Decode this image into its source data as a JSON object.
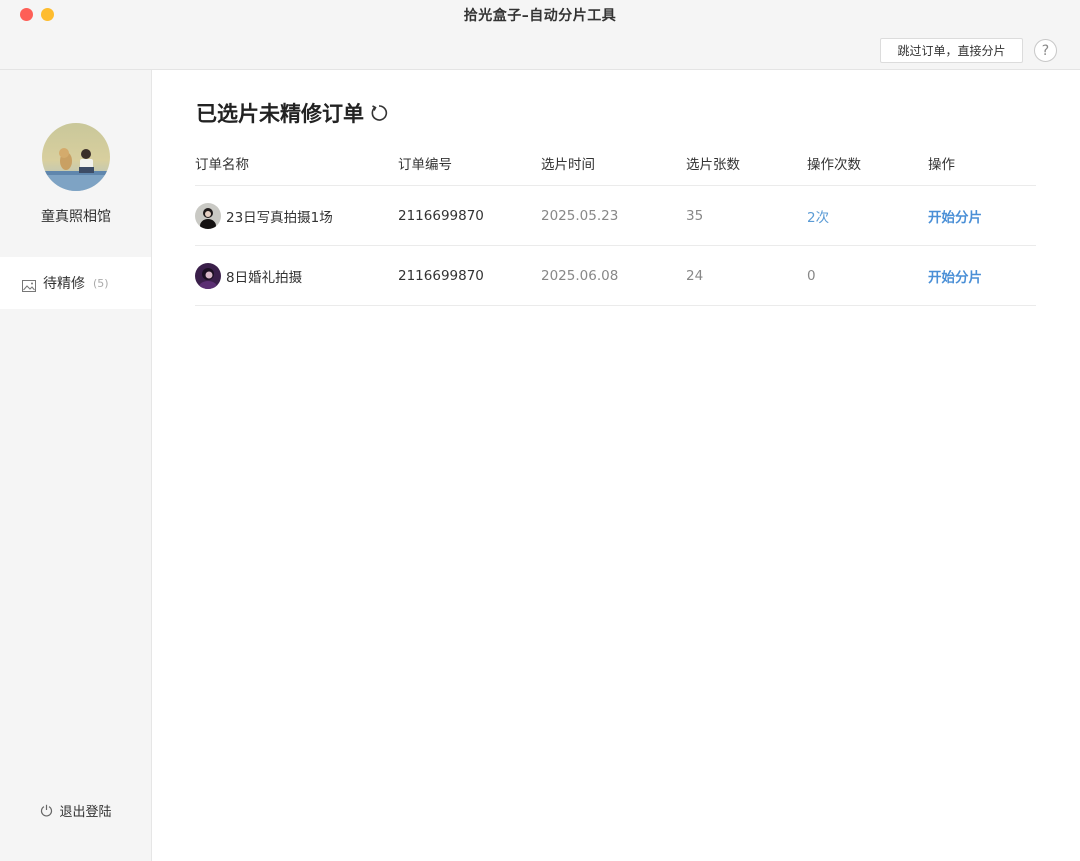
{
  "window": {
    "title": "拾光盒子–自动分片工具",
    "skip_button": "跳过订单，直接分片",
    "help_label": "?"
  },
  "sidebar": {
    "studio_name": "童真照相馆",
    "nav": [
      {
        "label": "待精修",
        "count": "(5)",
        "icon": "image-icon"
      }
    ],
    "logout_label": "退出登陆"
  },
  "main": {
    "title": "已选片未精修订单",
    "columns": [
      "订单名称",
      "订单编号",
      "选片时间",
      "选片张数",
      "操作次数",
      "操作"
    ],
    "rows": [
      {
        "name": "23日写真拍摄1场",
        "order_no": "2116699870",
        "time": "2025.05.23",
        "count": "35",
        "ops": "2次",
        "action": "开始分片"
      },
      {
        "name": "8日婚礼拍摄",
        "order_no": "2116699870",
        "time": "2025.06.08",
        "count": "24",
        "ops": "0",
        "action": "开始分片"
      }
    ]
  },
  "colors": {
    "accent": "#4a8fd6",
    "link_light": "#5b9bd5",
    "sidebar_bg": "#f5f5f5"
  }
}
